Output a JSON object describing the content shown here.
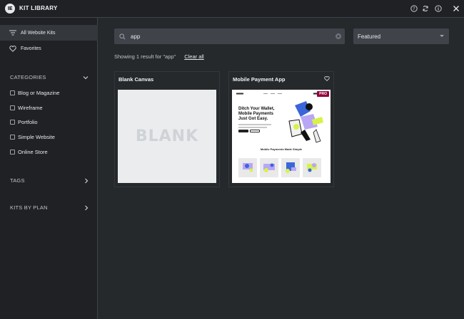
{
  "header": {
    "logo_text": "IE",
    "title": "KIT LIBRARY",
    "icons": [
      "help-icon",
      "sync-icon",
      "info-icon",
      "close-icon"
    ]
  },
  "sidebar": {
    "items": [
      {
        "label": "All Website Kits",
        "icon": "filter-icon",
        "active": true
      },
      {
        "label": "Favorites",
        "icon": "heart-icon",
        "active": false
      }
    ],
    "categories_label": "CATEGORIES",
    "categories": [
      "Blog or Magazine",
      "Wireframe",
      "Portfolio",
      "Simple Website",
      "Online Store"
    ],
    "tags_label": "TAGS",
    "kits_by_plan_label": "KITS BY PLAN"
  },
  "search": {
    "value": "app",
    "placeholder": "Search all Website Kits..."
  },
  "sort": {
    "selected": "Featured"
  },
  "summary": {
    "text": "Showing 1 result for \"app\"",
    "clear_label": "Clear all"
  },
  "cards": [
    {
      "title": "Blank Canvas",
      "thumb_text": "BLANK"
    },
    {
      "title": "Mobile Payment App",
      "badge": "PRO",
      "hero_text": "Ditch Your Wallet, Mobile Payments Just Got Easy.",
      "caption": "Mobile Payments Made Simple"
    }
  ],
  "colors": {
    "background": "#26292c",
    "sidebar": "#1f2124",
    "input": "#404349",
    "pro_badge": "#92003b"
  }
}
